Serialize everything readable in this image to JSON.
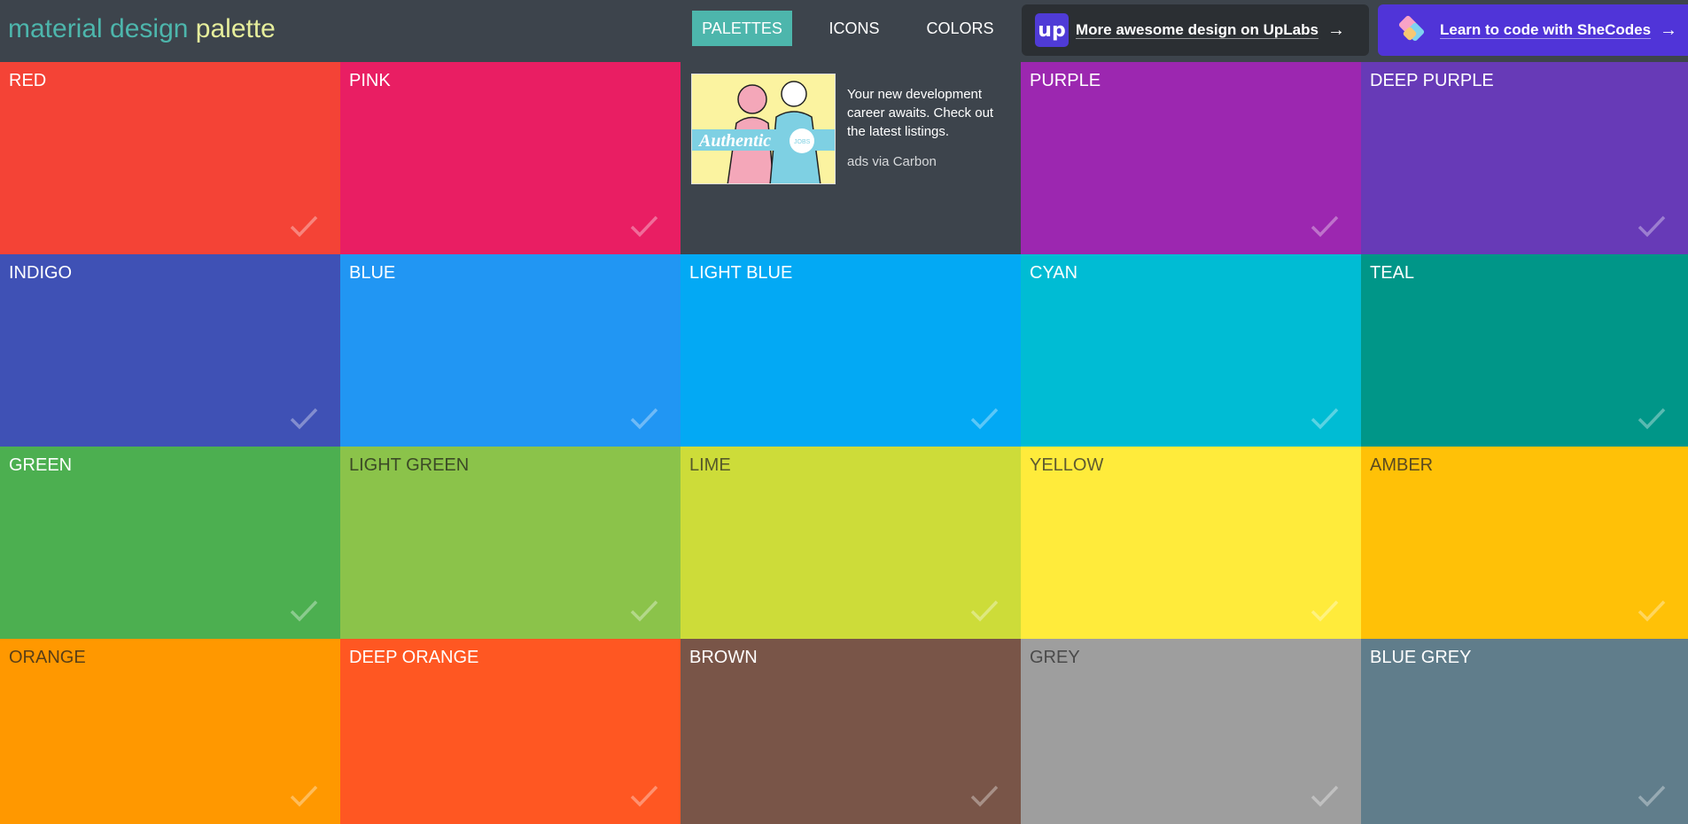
{
  "header": {
    "brand_part1": "material design",
    "brand_part2": "palette",
    "nav": [
      {
        "label": "PALETTES",
        "active": true
      },
      {
        "label": "ICONS",
        "active": false
      },
      {
        "label": "COLORS",
        "active": false
      }
    ],
    "uplabs": {
      "logo_text": "up",
      "label": "More awesome design on UpLabs",
      "arrow": "→"
    },
    "shecodes": {
      "label": "Learn to code with SheCodes",
      "arrow": "→"
    }
  },
  "ad": {
    "text": "Your new development career awaits. Check out the latest listings.",
    "via": "ads via Carbon",
    "image_text": "Authentic",
    "image_badge": "JOBS"
  },
  "tiles": [
    {
      "name": "RED",
      "color": "#f44336",
      "text_color": "#ffffff"
    },
    {
      "name": "PINK",
      "color": "#e91e63",
      "text_color": "#ffffff"
    },
    {
      "name": "PURPLE",
      "color": "#9c27b0",
      "text_color": "#ffffff"
    },
    {
      "name": "DEEP PURPLE",
      "color": "#673ab7",
      "text_color": "#ffffff"
    },
    {
      "name": "INDIGO",
      "color": "#3f51b5",
      "text_color": "#ffffff"
    },
    {
      "name": "BLUE",
      "color": "#2196f3",
      "text_color": "#ffffff"
    },
    {
      "name": "LIGHT BLUE",
      "color": "#03a9f4",
      "text_color": "#ffffff"
    },
    {
      "name": "CYAN",
      "color": "#00bcd4",
      "text_color": "#ffffff"
    },
    {
      "name": "TEAL",
      "color": "#009688",
      "text_color": "#ffffff"
    },
    {
      "name": "GREEN",
      "color": "#4caf50",
      "text_color": "#ffffff"
    },
    {
      "name": "LIGHT GREEN",
      "color": "#8bc34a",
      "text_color": "#3b4a26"
    },
    {
      "name": "LIME",
      "color": "#cddc39",
      "text_color": "#55592a"
    },
    {
      "name": "YELLOW",
      "color": "#ffeb3b",
      "text_color": "#5e5a30"
    },
    {
      "name": "AMBER",
      "color": "#ffc107",
      "text_color": "#5a4a20"
    },
    {
      "name": "ORANGE",
      "color": "#ff9800",
      "text_color": "#5a3f17"
    },
    {
      "name": "DEEP ORANGE",
      "color": "#ff5722",
      "text_color": "#ffffff"
    },
    {
      "name": "BROWN",
      "color": "#795548",
      "text_color": "#ffffff"
    },
    {
      "name": "GREY",
      "color": "#9e9e9e",
      "text_color": "#4a4a4a"
    },
    {
      "name": "BLUE GREY",
      "color": "#607d8b",
      "text_color": "#ffffff"
    }
  ]
}
